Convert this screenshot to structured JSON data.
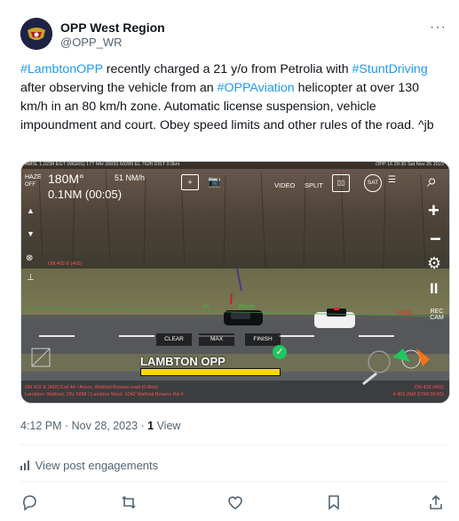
{
  "author": {
    "name": "OPP West Region",
    "handle": "@OPP_WR"
  },
  "tweet": {
    "parts": [
      {
        "tag": "#LambtonOPP"
      },
      {
        "text": " recently charged a 21 y/o from Petrolia with "
      },
      {
        "tag": "#StuntDriving"
      },
      {
        "text": " after observing the vehicle from an "
      },
      {
        "tag": "#OPPAviation"
      },
      {
        "text": " helicopter at over 130 km/h in an 80 km/h zone. Automatic license suspension, vehicle impoundment and court. Obey speed limits and other rules of the road. ^jb"
      }
    ],
    "timestamp": "4:12 PM · Nov 28, 2023 · ",
    "views_count": "1",
    "views_label": " View",
    "engagements_label": "View post engagements"
  },
  "overlay": {
    "top_bar": "AMSL 1,023ft EGT (MGRS) 17T MH 28933 60289 EL 762ft DIST 0.5km",
    "top_right": "OPP 16 29:30 Sat Nov 25 2023",
    "heading": "180M°",
    "speed": "51 NM/h",
    "distance": "0.1NM (00:05)",
    "haze": "HAZE",
    "off": "OFF",
    "video": "VIDEO",
    "split": "SPLIT",
    "sat": "SAT",
    "clear": "CLEAR",
    "max": "MAX",
    "finish": "FINISH",
    "stamp": "LAMBTON OPP",
    "rec": "REC",
    "rec_cam": "REC CAM",
    "bottom_left": "ON 402 E (402) Exit 44 / Acorn, Watford Browns road (0.8km)",
    "bottom_left2": "Lambton: Watford, ON, N0M / Lambton West. 1042 Watford Browns Rd 4",
    "bottom_right": "ON 402 (402)",
    "bottom_right2": "4 402 (NM STIM 06:65)",
    "road_label": "ON 402 E (402)",
    "colors": {
      "accent": "#1d9bf0",
      "red": "#ff2020",
      "green": "#22c55e",
      "yellow": "#f5d90a"
    }
  }
}
